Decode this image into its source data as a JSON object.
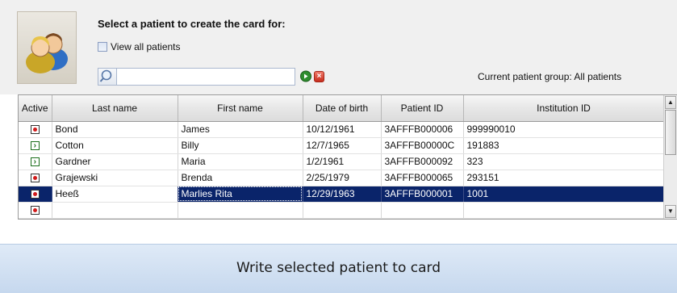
{
  "header": {
    "title": "Select a patient to create the card for:",
    "view_all_label": "View all patients",
    "view_all_checked": false,
    "search": {
      "value": "",
      "placeholder": ""
    },
    "group_label": "Current patient group: All patients"
  },
  "table": {
    "columns": [
      "Active",
      "Last name",
      "First name",
      "Date of birth",
      "Patient ID",
      "Institution ID"
    ],
    "rows": [
      {
        "status": "inactive-red-dot",
        "last": "Bond",
        "first": "James",
        "dob": "10/12/1961",
        "pid": "3AFFFB000006",
        "iid": "999990010"
      },
      {
        "status": "active-green-arrow",
        "last": "Cotton",
        "first": "Billy",
        "dob": "12/7/1965",
        "pid": "3AFFFB00000C",
        "iid": "191883"
      },
      {
        "status": "active-green-arrow",
        "last": "Gardner",
        "first": "Maria",
        "dob": "1/2/1961",
        "pid": "3AFFFB000092",
        "iid": "323"
      },
      {
        "status": "inactive-red-dot",
        "last": "Grajewski",
        "first": "Brenda",
        "dob": "2/25/1979",
        "pid": "3AFFFB000065",
        "iid": "293151"
      },
      {
        "status": "inactive-red-dot",
        "last": "Heeß",
        "first": "Marlies Rita",
        "dob": "12/29/1963",
        "pid": "3AFFFB000001",
        "iid": "1001"
      }
    ],
    "selected_row": 4
  },
  "actions": {
    "write_label": "Write selected patient to card"
  },
  "colors": {
    "selection": "#0a246a",
    "button_bg": "#d2e1f2",
    "status_red": "#d11a1a",
    "status_green": "#1b6e1b"
  }
}
